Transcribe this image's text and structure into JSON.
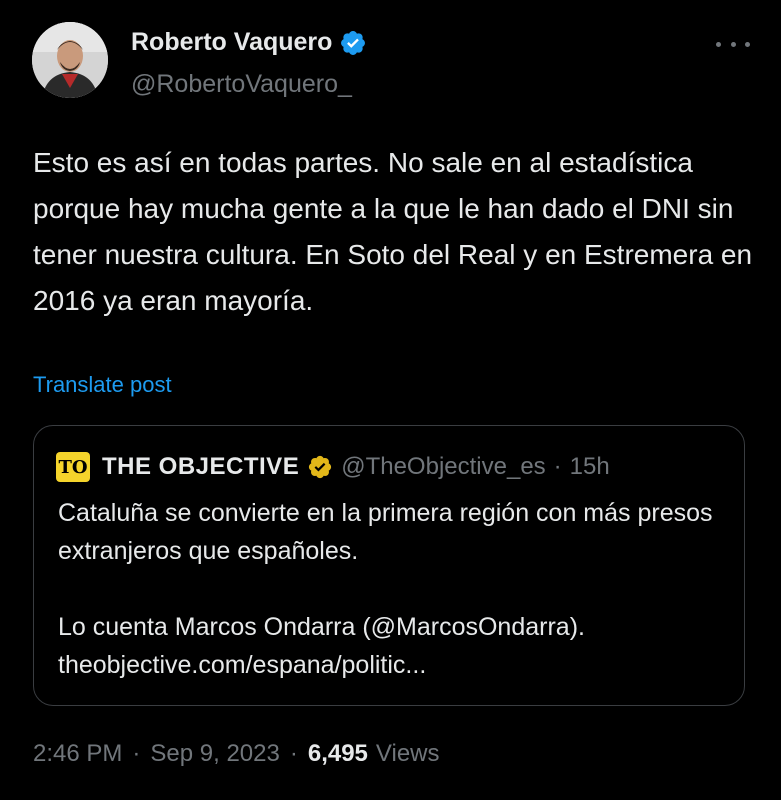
{
  "author": {
    "name": "Roberto Vaquero",
    "handle": "@RobertoVaquero_"
  },
  "post": {
    "text": "Esto es así en todas partes. No sale en al estadística porque hay mucha gente a la que le han dado el DNI sin tener nuestra cultura. En Soto del Real y en Estremera en 2016 ya eran mayoría.",
    "translate_label": "Translate post",
    "time": "2:46 PM",
    "date": "Sep 9, 2023",
    "views_count": "6,495",
    "views_label": "Views",
    "separator": "·"
  },
  "quoted": {
    "logo_text": "TO",
    "name": "THE OBJECTIVE",
    "handle": "@TheObjective_es",
    "separator": "·",
    "time": "15h",
    "line1": "Cataluña se convierte en la primera región con más presos extranjeros que españoles.",
    "line2": "Lo cuenta Marcos Ondarra (@MarcosOndarra).",
    "link": "theobjective.com/espana/politic..."
  },
  "colors": {
    "background": "#000000",
    "text": "#e7e9ea",
    "secondary": "#71767b",
    "link": "#1d9bf0",
    "verified_blue": "#1d9bf0",
    "verified_gold": "#e2b719"
  },
  "icons": {
    "verified_author": "verified-badge-blue-icon",
    "verified_quoted": "verified-badge-gold-icon",
    "more": "more-options-icon"
  }
}
